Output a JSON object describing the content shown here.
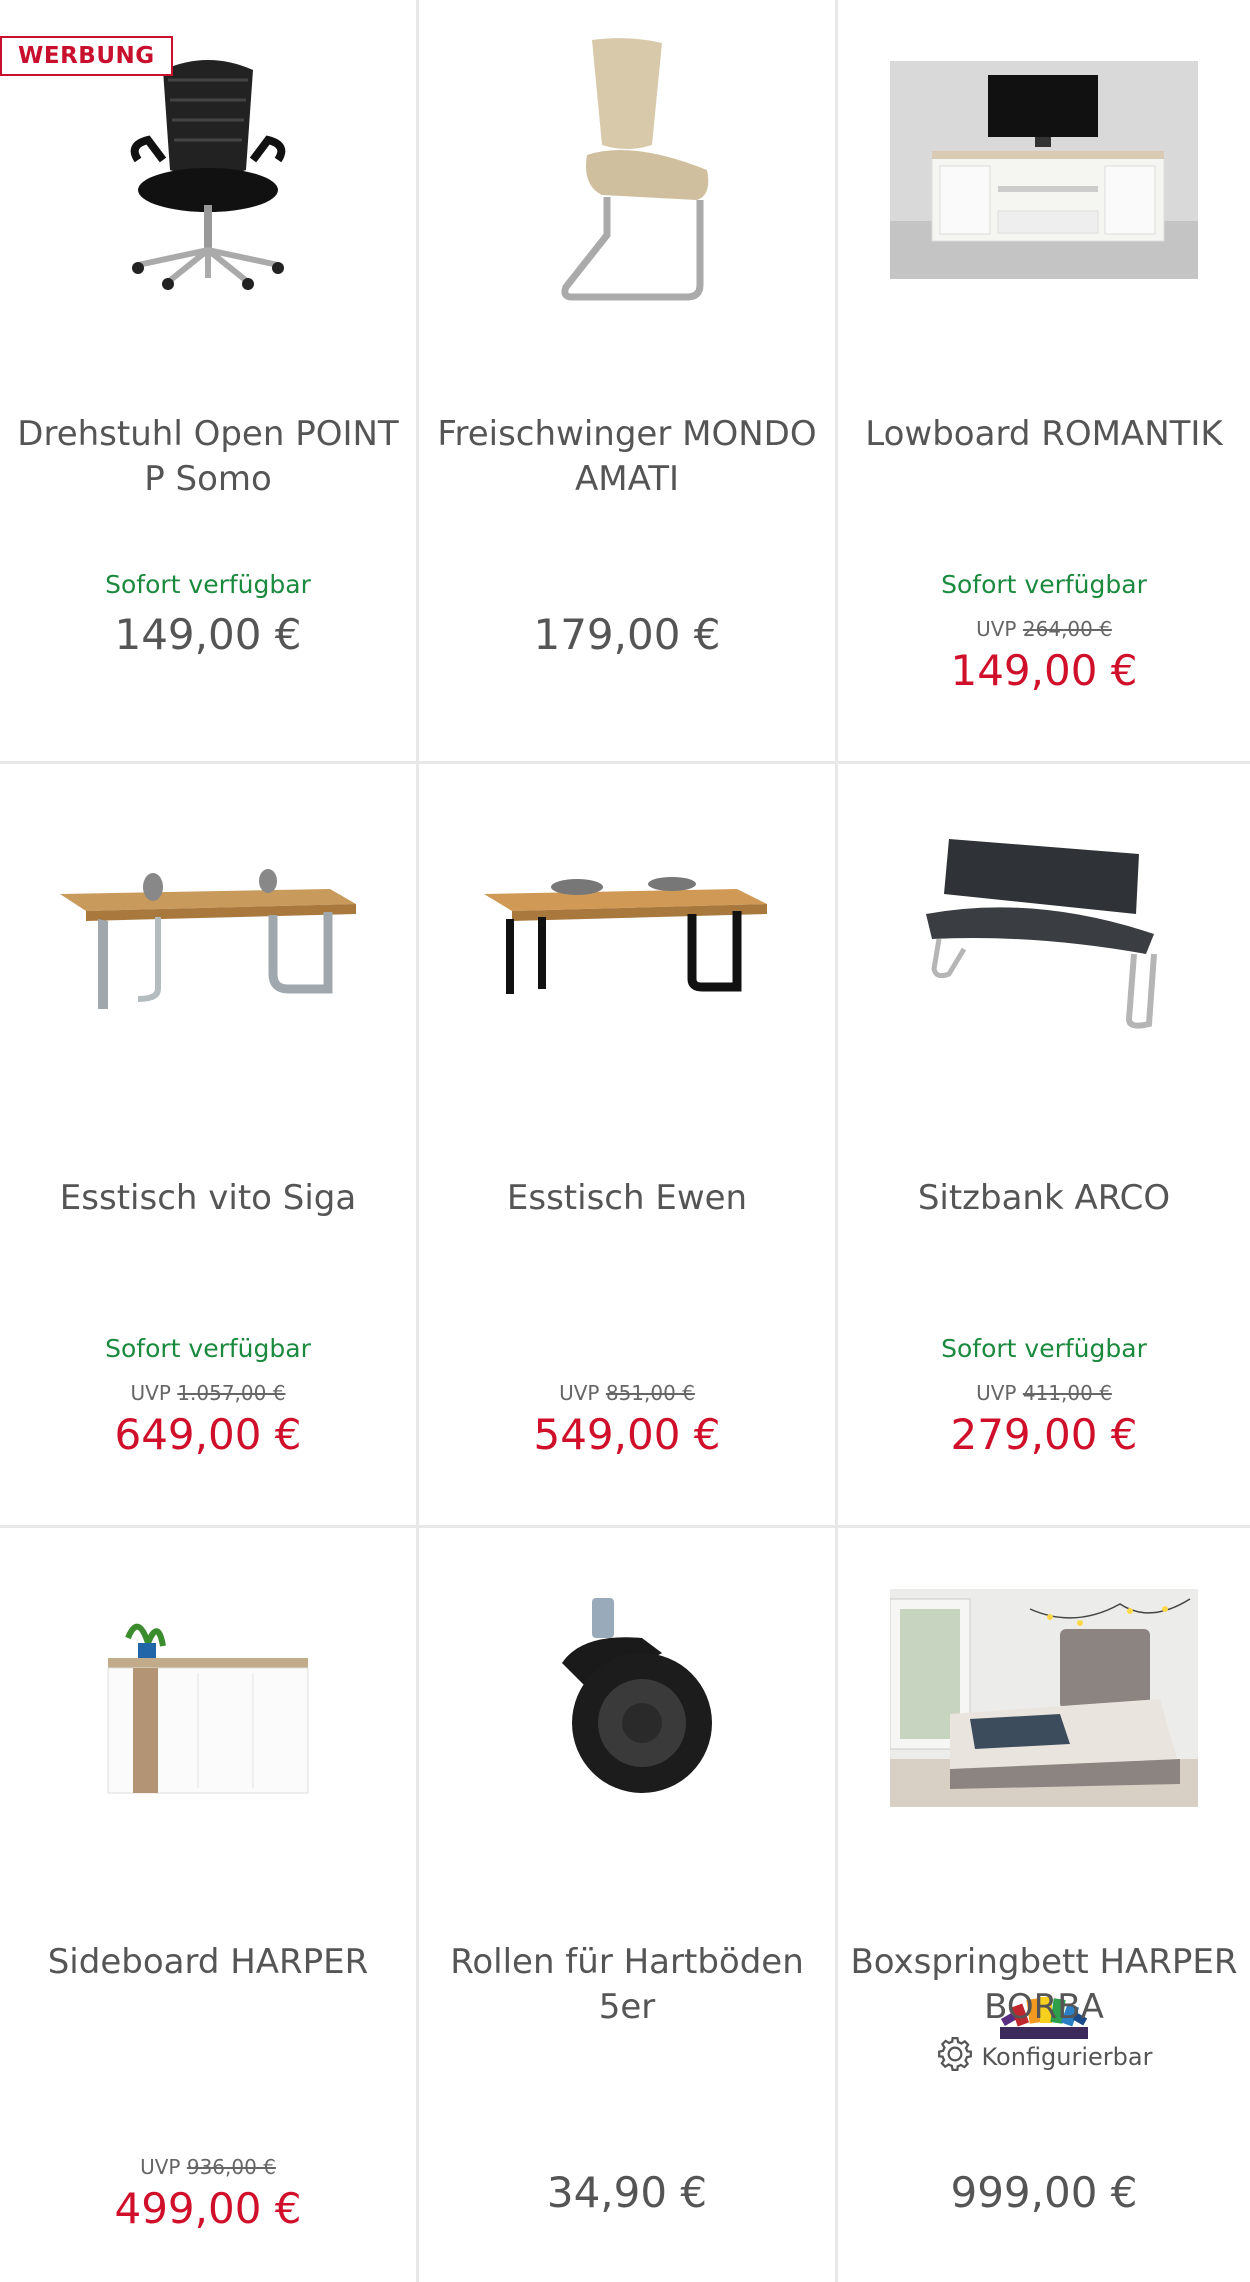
{
  "ad_label": "WERBUNG",
  "colors": {
    "available": "#1b8a3e",
    "sale": "#d0102a",
    "ad": "#c8102e"
  },
  "products": [
    {
      "title": "Drehstuhl Open POINT P Somo",
      "availability": "Sofort verfügbar",
      "price": "149,00 €",
      "icon": "office-chair-image"
    },
    {
      "title": "Freischwinger MONDO AMATI",
      "price": "179,00 €",
      "icon": "cantilever-chair-image"
    },
    {
      "title": "Lowboard ROMANTIK",
      "availability": "Sofort verfügbar",
      "uvp_label": "UVP",
      "uvp": "264,00 €",
      "price": "149,00 €",
      "icon": "tv-lowboard-image"
    },
    {
      "title": "Esstisch vito Siga",
      "availability": "Sofort verfügbar",
      "uvp_label": "UVP",
      "uvp": "1.057,00 €",
      "price": "649,00 €",
      "icon": "dining-table-image"
    },
    {
      "title": "Esstisch Ewen",
      "uvp_label": "UVP",
      "uvp": "851,00 €",
      "price": "549,00 €",
      "icon": "dining-table-black-legs-image"
    },
    {
      "title": "Sitzbank ARCO",
      "availability": "Sofort verfügbar",
      "uvp_label": "UVP",
      "uvp": "411,00 €",
      "price": "279,00 €",
      "icon": "bench-image"
    },
    {
      "title": "Sideboard HARPER",
      "uvp_label": "UVP",
      "uvp": "936,00 €",
      "price": "499,00 €",
      "icon": "sideboard-image"
    },
    {
      "title": "Rollen für Hartböden 5er",
      "price": "34,90 €",
      "icon": "caster-wheel-image"
    },
    {
      "title": "Boxspringbett HARPER BORBA",
      "config_label": "Konfigurierbar",
      "price": "999,00 €",
      "icon": "boxspring-bed-image"
    }
  ]
}
